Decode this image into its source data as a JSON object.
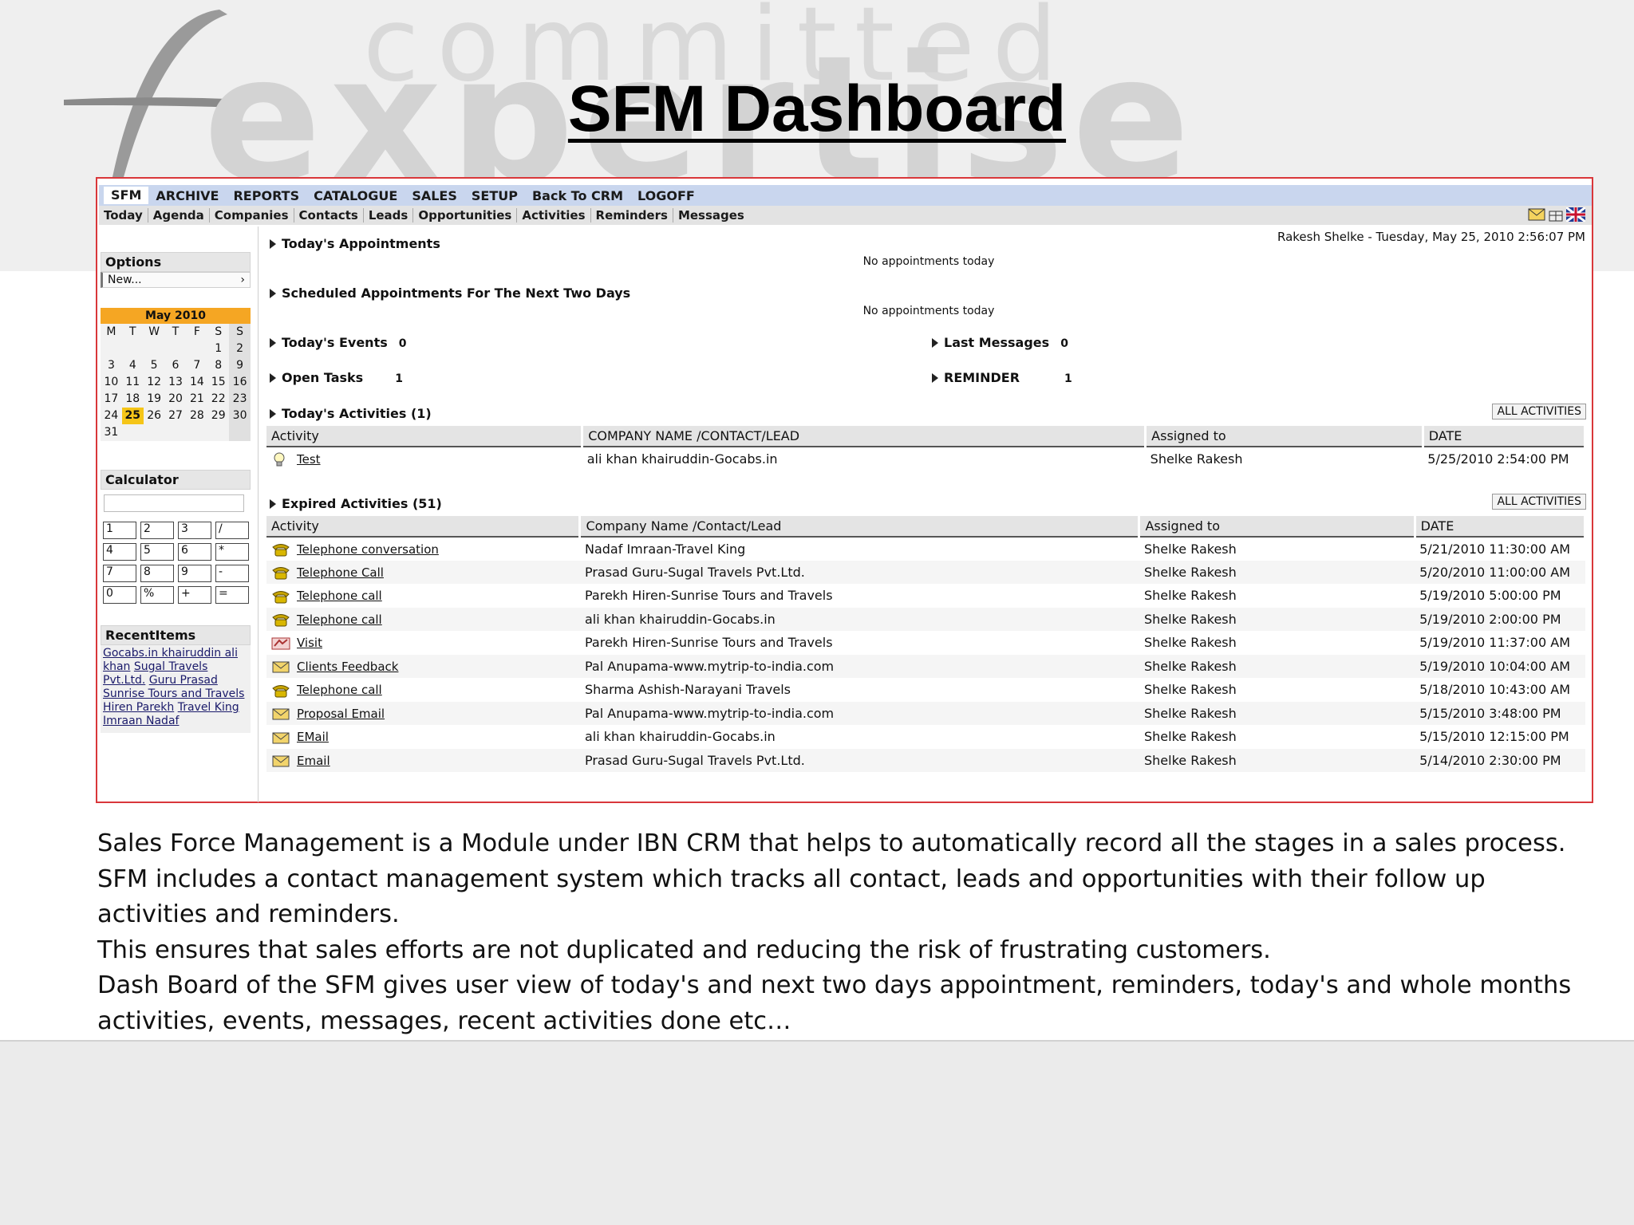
{
  "slide": {
    "title": "SFM Dashboard",
    "watermark_top": "committed",
    "watermark_bottom": "expertise",
    "description": [
      "Sales Force Management is a Module under IBN CRM that helps to automatically record all the stages in a sales process.",
      "SFM includes a contact management system which tracks all contact, leads and opportunities with their follow up activities and reminders.",
      "This ensures that sales efforts are not duplicated and reducing the risk of frustrating customers.",
      "Dash Board of the SFM gives user view of  today's and next two days appointment, reminders, today's  and whole months activities, events, messages, recent activities done etc…"
    ]
  },
  "menu": [
    "SFM",
    "ARCHIVE",
    "REPORTS",
    "CATALOGUE",
    "SALES",
    "SETUP",
    "Back To CRM",
    "LOGOFF"
  ],
  "subnav": [
    "Today",
    "Agenda",
    "Companies",
    "Contacts",
    "Leads",
    "Opportunities",
    "Activities",
    "Reminders",
    "Messages"
  ],
  "subnav_icons": [
    "mail-icon",
    "gift-icon",
    "flag-uk-icon"
  ],
  "user_line": "Rakesh Shelke - Tuesday, May 25, 2010 2:56:07 PM",
  "sidebar": {
    "options_title": "Options",
    "options_value": "New...",
    "calendar": {
      "month": "May 2010",
      "weekdays": [
        "M",
        "T",
        "W",
        "T",
        "F",
        "S",
        "S"
      ],
      "weeks": [
        [
          "",
          "",
          "",
          "",
          "",
          "1",
          "2"
        ],
        [
          "3",
          "4",
          "5",
          "6",
          "7",
          "8",
          "9"
        ],
        [
          "10",
          "11",
          "12",
          "13",
          "14",
          "15",
          "16"
        ],
        [
          "17",
          "18",
          "19",
          "20",
          "21",
          "22",
          "23"
        ],
        [
          "24",
          "25",
          "26",
          "27",
          "28",
          "29",
          "30"
        ],
        [
          "31",
          "",
          "",
          "",
          "",
          "",
          ""
        ]
      ],
      "today": "25"
    },
    "calculator_title": "Calculator",
    "calc_keys": [
      "1",
      "2",
      "3",
      "/",
      "4",
      "5",
      "6",
      "*",
      "7",
      "8",
      "9",
      "-",
      "0",
      "%",
      "+",
      "="
    ],
    "recent_title": "RecentItems",
    "recent_items": [
      "Gocabs.in khairuddin ali khan",
      "Sugal Travels Pvt.Ltd.",
      "Guru Prasad",
      "Sunrise Tours and Travels Hiren Parekh",
      "Travel King Imraan Nadaf"
    ]
  },
  "main": {
    "appointments_title": "Today's Appointments",
    "appointments_msg": "No appointments today",
    "scheduled_title": "Scheduled Appointments For The Next Two Days",
    "scheduled_msg": "No appointments today",
    "events_title": "Today's Events",
    "events_count": "0",
    "last_messages_title": "Last Messages",
    "last_messages_count": "0",
    "open_tasks_title": "Open Tasks",
    "open_tasks_count": "1",
    "reminder_title": "REMINDER",
    "reminder_count": "1",
    "all_activities_label": "ALL ACTIVITIES",
    "todays_activities": {
      "title": "Today's Activities (1)",
      "columns": [
        "Activity",
        "COMPANY NAME /CONTACT/LEAD",
        "Assigned to",
        "DATE"
      ],
      "rows": [
        {
          "icon": "lightbulb-icon",
          "activity": "Test",
          "company": "ali khan khairuddin-Gocabs.in",
          "assigned": "Shelke Rakesh",
          "date": "5/25/2010 2:54:00 PM"
        }
      ]
    },
    "expired_activities": {
      "title": "Expired Activities (51)",
      "columns": [
        "Activity",
        "Company Name /Contact/Lead",
        "Assigned to",
        "DATE"
      ],
      "rows": [
        {
          "icon": "telephone-icon",
          "activity": "Telephone conversation",
          "company": "Nadaf Imraan-Travel King",
          "assigned": "Shelke Rakesh",
          "date": "5/21/2010 11:30:00 AM"
        },
        {
          "icon": "telephone-icon",
          "activity": "Telephone Call",
          "company": "Prasad Guru-Sugal Travels Pvt.Ltd.",
          "assigned": "Shelke Rakesh",
          "date": "5/20/2010 11:00:00 AM"
        },
        {
          "icon": "telephone-icon",
          "activity": "Telephone call",
          "company": "Parekh Hiren-Sunrise Tours and Travels",
          "assigned": "Shelke Rakesh",
          "date": "5/19/2010 5:00:00 PM"
        },
        {
          "icon": "telephone-icon",
          "activity": "Telephone call",
          "company": "ali khan khairuddin-Gocabs.in",
          "assigned": "Shelke Rakesh",
          "date": "5/19/2010 2:00:00 PM"
        },
        {
          "icon": "handshake-icon",
          "activity": "Visit",
          "company": "Parekh Hiren-Sunrise Tours and Travels",
          "assigned": "Shelke Rakesh",
          "date": "5/19/2010 11:37:00 AM"
        },
        {
          "icon": "envelope-icon",
          "activity": "Clients Feedback",
          "company": "Pal Anupama-www.mytrip-to-india.com",
          "assigned": "Shelke Rakesh",
          "date": "5/19/2010 10:04:00 AM"
        },
        {
          "icon": "telephone-icon",
          "activity": "Telephone call",
          "company": "Sharma Ashish-Narayani Travels",
          "assigned": "Shelke Rakesh",
          "date": "5/18/2010 10:43:00 AM"
        },
        {
          "icon": "envelope-icon",
          "activity": "Proposal Email",
          "company": "Pal Anupama-www.mytrip-to-india.com",
          "assigned": "Shelke Rakesh",
          "date": "5/15/2010 3:48:00 PM"
        },
        {
          "icon": "envelope-icon",
          "activity": "EMail",
          "company": "ali khan khairuddin-Gocabs.in",
          "assigned": "Shelke Rakesh",
          "date": "5/15/2010 12:15:00 PM"
        },
        {
          "icon": "envelope-icon",
          "activity": "Email",
          "company": "Prasad Guru-Sugal Travels Pvt.Ltd.",
          "assigned": "Shelke Rakesh",
          "date": "5/14/2010 2:30:00 PM"
        }
      ]
    }
  },
  "colors": {
    "frame_border": "#d9373a",
    "menubar": "#c9d6ee",
    "calendar_header": "#f5a623",
    "calendar_today": "#f5c518"
  }
}
